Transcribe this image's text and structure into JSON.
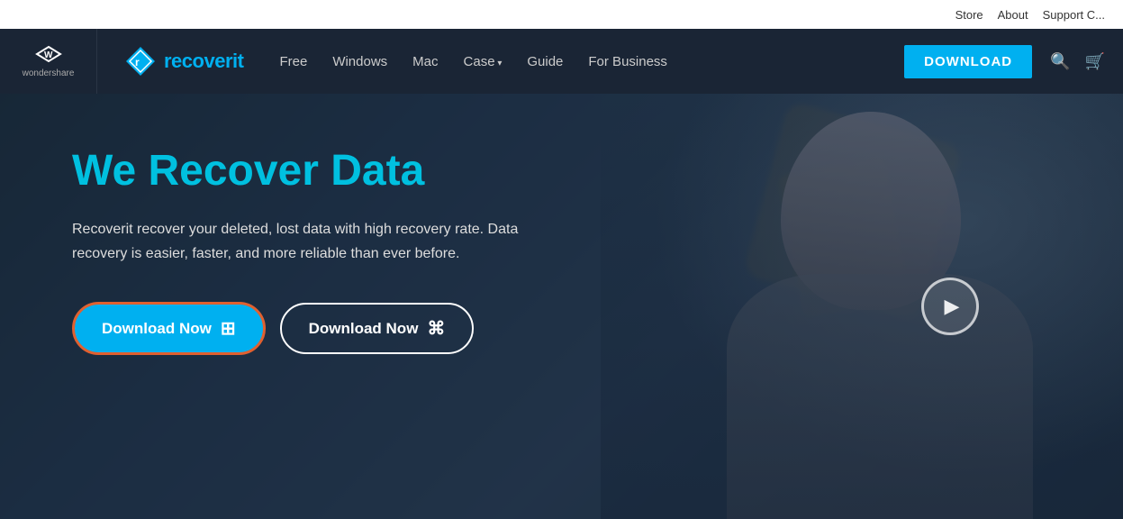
{
  "topbar": {
    "links": [
      "Store",
      "About",
      "Support C..."
    ]
  },
  "navbar": {
    "brand1": "wondershare",
    "brand2_part1": "recover",
    "brand2_part2": "it",
    "nav_items": [
      {
        "label": "Free",
        "has_dropdown": false
      },
      {
        "label": "Windows",
        "has_dropdown": false
      },
      {
        "label": "Mac",
        "has_dropdown": false
      },
      {
        "label": "Case",
        "has_dropdown": true
      },
      {
        "label": "Guide",
        "has_dropdown": false
      },
      {
        "label": "For Business",
        "has_dropdown": false
      }
    ],
    "download_btn": "DOWNLOAD"
  },
  "hero": {
    "title": "We Recover Data",
    "subtitle": "Recoverit recover your deleted, lost data with high recovery rate. Data recovery is easier, faster, and more reliable than ever before.",
    "btn_windows": "Download Now",
    "btn_mac": "Download Now"
  },
  "colors": {
    "cyan": "#00b0f0",
    "dark_nav": "#1a2535",
    "orange_border": "#e06030"
  }
}
